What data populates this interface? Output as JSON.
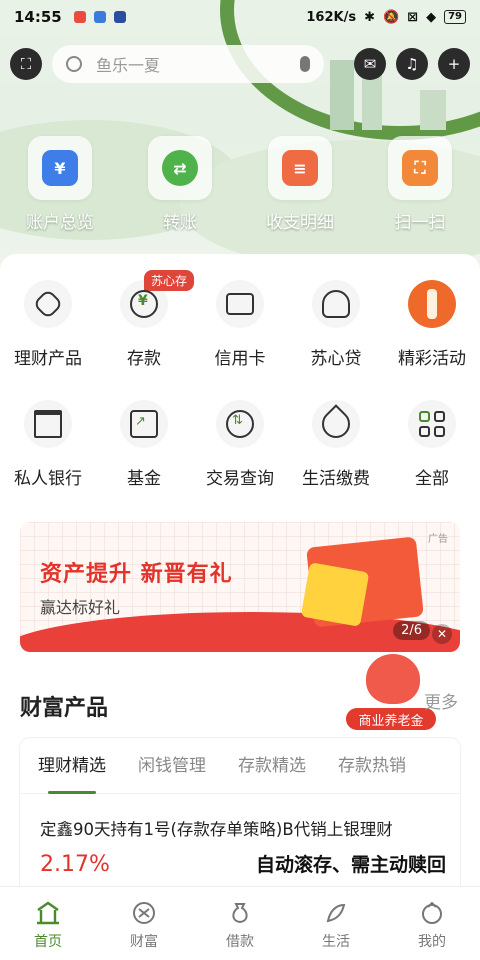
{
  "status_bar": {
    "time": "14:55",
    "network_speed": "162K/s",
    "battery": "79"
  },
  "search": {
    "placeholder": "鱼乐一夏"
  },
  "quick_actions": [
    {
      "label": "账户总览",
      "icon": "wallet-icon",
      "color": "#3f7ee8",
      "glyph": "¥"
    },
    {
      "label": "转账",
      "icon": "transfer-icon",
      "color": "#4fb24a",
      "glyph": "⇄"
    },
    {
      "label": "收支明细",
      "icon": "statement-icon",
      "color": "#ef6b43",
      "glyph": "≡"
    },
    {
      "label": "扫一扫",
      "icon": "scan-icon",
      "color": "#f2893a",
      "glyph": "⛶"
    }
  ],
  "services_row1": [
    {
      "label": "理财产品",
      "icon": "wealth-icon"
    },
    {
      "label": "存款",
      "icon": "deposit-icon",
      "badge": "苏心存"
    },
    {
      "label": "信用卡",
      "icon": "credit-card-icon"
    },
    {
      "label": "苏心贷",
      "icon": "loan-icon"
    },
    {
      "label": "精彩活动",
      "icon": "activity-icon"
    }
  ],
  "services_row2": [
    {
      "label": "私人银行",
      "icon": "bank-icon"
    },
    {
      "label": "基金",
      "icon": "fund-icon"
    },
    {
      "label": "交易查询",
      "icon": "transaction-query-icon"
    },
    {
      "label": "生活缴费",
      "icon": "utility-payment-icon"
    },
    {
      "label": "全部",
      "icon": "all-icon"
    }
  ],
  "banner": {
    "title": "资产提升  新晋有礼",
    "subtitle": "赢达标好礼",
    "ad_label": "广告",
    "pager": "2/6"
  },
  "wealth": {
    "title": "财富产品",
    "more": "更多",
    "promo_label": "商业养老金",
    "tabs": [
      "理财精选",
      "闲钱管理",
      "存款精选",
      "存款热销"
    ],
    "product": {
      "name": "定鑫90天持有1号(存款存单策略)B代销上银理财",
      "rate": "2.17%",
      "feature": "自动滚存、需主动赎回"
    }
  },
  "bottom_nav": [
    {
      "label": "首页",
      "icon": "home-icon",
      "active": true
    },
    {
      "label": "财富",
      "icon": "wealth-nav-icon"
    },
    {
      "label": "借款",
      "icon": "loan-nav-icon"
    },
    {
      "label": "生活",
      "icon": "life-nav-icon"
    },
    {
      "label": "我的",
      "icon": "profile-nav-icon"
    }
  ],
  "colors": {
    "brand_green": "#4a8a2c",
    "accent_red": "#e3332b"
  }
}
